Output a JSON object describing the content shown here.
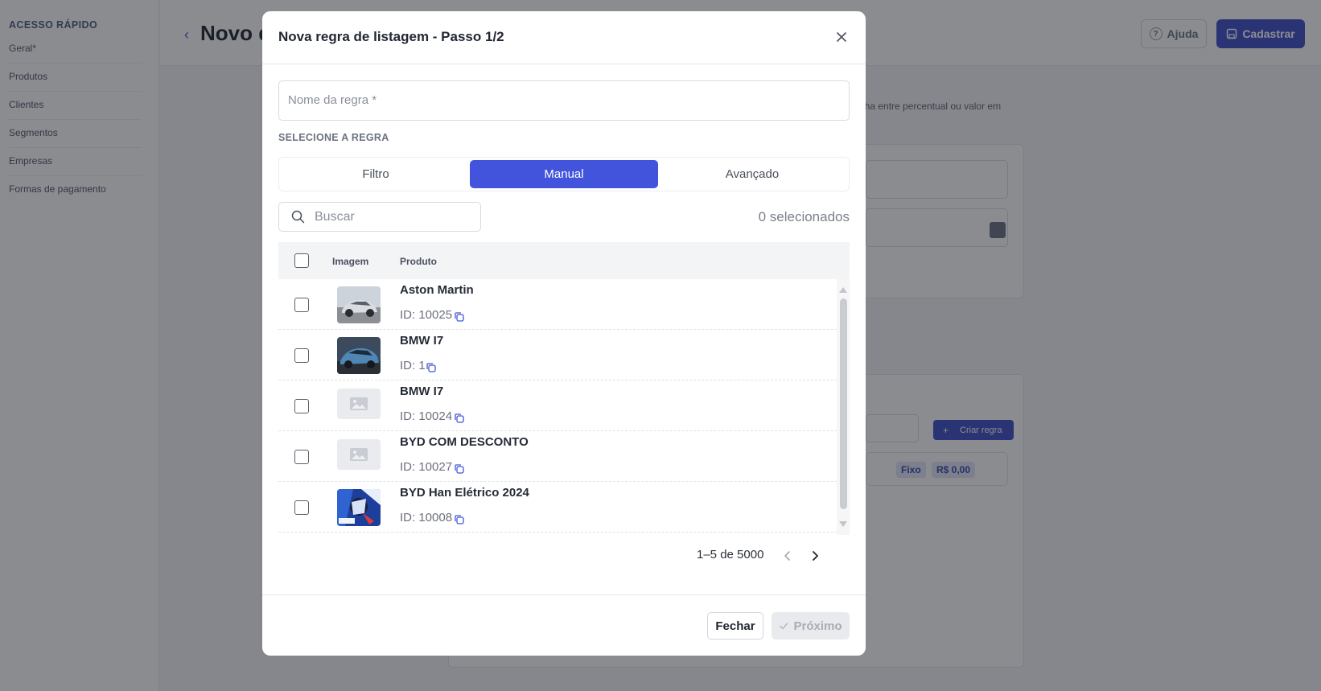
{
  "sidebar": {
    "title": "ACESSO RÁPIDO",
    "items": [
      {
        "label": "Geral*"
      },
      {
        "label": "Produtos"
      },
      {
        "label": "Clientes"
      },
      {
        "label": "Segmentos"
      },
      {
        "label": "Empresas"
      },
      {
        "label": "Formas de pagamento"
      }
    ]
  },
  "header": {
    "title": "Novo d",
    "help_label": "Ajuda",
    "register_label": "Cadastrar"
  },
  "background": {
    "hint": "lha entre percentual ou valor em",
    "create_rule_label": "Criar regra",
    "badge_type": "Fixo",
    "badge_value": "R$ 0,00"
  },
  "modal": {
    "title": "Nova regra de listagem - Passo 1/2",
    "name_placeholder": "Nome da regra *",
    "section_label": "SELECIONE A REGRA",
    "tabs": [
      {
        "label": "Filtro",
        "active": false
      },
      {
        "label": "Manual",
        "active": true
      },
      {
        "label": "Avançado",
        "active": false
      }
    ],
    "search_placeholder": "Buscar",
    "selected_count": "0 selecionados",
    "table": {
      "columns": {
        "image": "Imagem",
        "product": "Produto"
      },
      "rows": [
        {
          "name": "Aston Martin",
          "id": "ID: 10025",
          "image": "silver-car"
        },
        {
          "name": "BMW I7",
          "id": "ID: 1",
          "image": "blue-car"
        },
        {
          "name": "BMW I7",
          "id": "ID: 10024",
          "image": "placeholder"
        },
        {
          "name": "BYD COM DESCONTO",
          "id": "ID: 10027",
          "image": "placeholder"
        },
        {
          "name": "BYD Han Elétrico 2024",
          "id": "ID: 10008",
          "image": "game-art"
        }
      ]
    },
    "pagination": {
      "range": "1–5 de 5000"
    },
    "footer": {
      "close_label": "Fechar",
      "next_label": "Próximo"
    }
  },
  "colors": {
    "accent": "#4254db",
    "overlay": "rgba(22,26,34,0.5)"
  }
}
